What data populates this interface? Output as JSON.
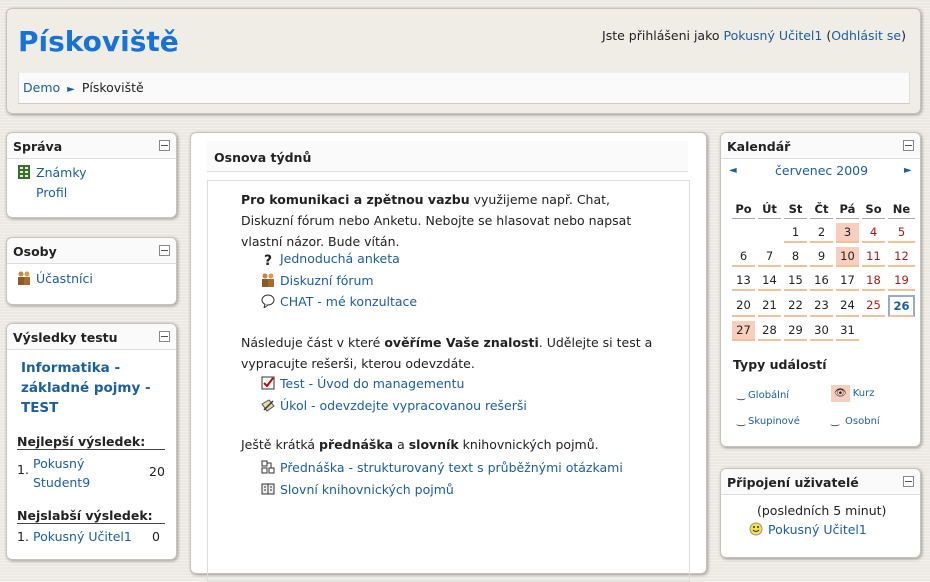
{
  "header": {
    "site_title": "Pískoviště",
    "login_prefix": "Jste přihlášeni jako ",
    "login_user": "Pokusný Učitel1",
    "logout_open": " (",
    "logout_label": "Odhlásit se",
    "logout_close": ")",
    "breadcrumb": {
      "home": "Demo",
      "separator": "►",
      "current": "Pískoviště"
    }
  },
  "left": {
    "sprava": {
      "title": "Správa",
      "items": [
        "Známky",
        "Profil"
      ]
    },
    "osoby": {
      "title": "Osoby",
      "items": [
        "Účastníci"
      ]
    },
    "vysledky": {
      "title": "Výsledky testu",
      "test_name": "Informatika - základné pojmy - TEST",
      "best_heading": "Nejlepší výsledek:",
      "best": {
        "rank": "1.",
        "name": "Pokusný Student9",
        "score": "20"
      },
      "worst_heading": "Nejslabší výsledek:",
      "worst": {
        "rank": "1.",
        "name": "Pokusný Učitel1",
        "score": "0"
      }
    }
  },
  "main": {
    "title": "Osnova týdnů",
    "p1": {
      "bold": "Pro komunikaci a zpětnou vazbu",
      "text": " využijeme např. Chat, Diskuzní fórum nebo Anketu. Nebojte se hlasovat nebo napsat vlastní názor. Bude vítán."
    },
    "acts1": [
      "Jednoduchá anketa",
      "Diskuzní fórum",
      "CHAT - mé konzultace"
    ],
    "p2": {
      "a": "Následuje část v které ",
      "bold": "ověříme Vaše znalosti",
      "b": ". Udělejte si test a vypracujte rešerši, kterou odevzdáte."
    },
    "acts2": [
      "Test - Úvod do managementu",
      "Úkol - odevzdejte vypracovanou rešerši"
    ],
    "p3": {
      "a": "Ještě krátká ",
      "bold1": "přednáška",
      "b": " a ",
      "bold2": "slovník",
      "c": " knihovnických pojmů."
    },
    "acts3": [
      "Přednáška - strukturovaný text s průběžnými otázkami",
      "Slovní knihovnických pojmů"
    ]
  },
  "calendar": {
    "title": "Kalendář",
    "prev": "◄",
    "month": "červenec 2009",
    "next": "►",
    "weekdays": [
      "Po",
      "Út",
      "St",
      "Čt",
      "Pá",
      "So",
      "Ne"
    ],
    "weeks": [
      [
        "",
        "",
        "1",
        "2",
        "3",
        "4",
        "5"
      ],
      [
        "6",
        "7",
        "8",
        "9",
        "10",
        "11",
        "12"
      ],
      [
        "13",
        "14",
        "15",
        "16",
        "17",
        "18",
        "19"
      ],
      [
        "20",
        "21",
        "22",
        "23",
        "24",
        "25",
        "26"
      ],
      [
        "27",
        "28",
        "29",
        "30",
        "31",
        "",
        ""
      ]
    ],
    "event_types_title": "Typy událostí",
    "event_types": [
      "Globální",
      "Kurz",
      "Skupinové",
      "Osobní"
    ]
  },
  "online": {
    "title": "Připojení uživatelé",
    "subtitle": "(posledních 5 minut)",
    "users": [
      "Pokusný Učitel1"
    ]
  },
  "colors": {
    "title_blue": "#1773d6",
    "link": "#1a5fa0",
    "weekend": "#b01818",
    "event_bg": "#f8cfbf"
  }
}
